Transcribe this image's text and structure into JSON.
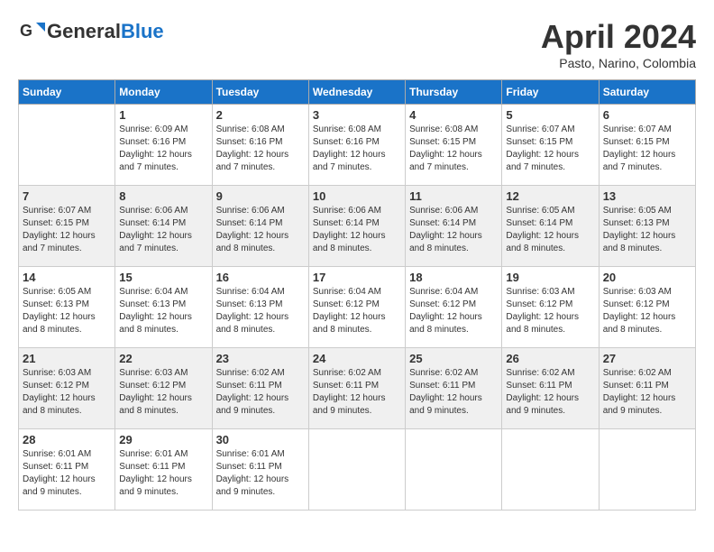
{
  "header": {
    "logo_general": "General",
    "logo_blue": "Blue",
    "month_year": "April 2024",
    "location": "Pasto, Narino, Colombia"
  },
  "weekdays": [
    "Sunday",
    "Monday",
    "Tuesday",
    "Wednesday",
    "Thursday",
    "Friday",
    "Saturday"
  ],
  "weeks": [
    [
      {
        "day": "",
        "info": ""
      },
      {
        "day": "1",
        "info": "Sunrise: 6:09 AM\nSunset: 6:16 PM\nDaylight: 12 hours\nand 7 minutes."
      },
      {
        "day": "2",
        "info": "Sunrise: 6:08 AM\nSunset: 6:16 PM\nDaylight: 12 hours\nand 7 minutes."
      },
      {
        "day": "3",
        "info": "Sunrise: 6:08 AM\nSunset: 6:16 PM\nDaylight: 12 hours\nand 7 minutes."
      },
      {
        "day": "4",
        "info": "Sunrise: 6:08 AM\nSunset: 6:15 PM\nDaylight: 12 hours\nand 7 minutes."
      },
      {
        "day": "5",
        "info": "Sunrise: 6:07 AM\nSunset: 6:15 PM\nDaylight: 12 hours\nand 7 minutes."
      },
      {
        "day": "6",
        "info": "Sunrise: 6:07 AM\nSunset: 6:15 PM\nDaylight: 12 hours\nand 7 minutes."
      }
    ],
    [
      {
        "day": "7",
        "info": "Sunrise: 6:07 AM\nSunset: 6:15 PM\nDaylight: 12 hours\nand 7 minutes."
      },
      {
        "day": "8",
        "info": "Sunrise: 6:06 AM\nSunset: 6:14 PM\nDaylight: 12 hours\nand 7 minutes."
      },
      {
        "day": "9",
        "info": "Sunrise: 6:06 AM\nSunset: 6:14 PM\nDaylight: 12 hours\nand 8 minutes."
      },
      {
        "day": "10",
        "info": "Sunrise: 6:06 AM\nSunset: 6:14 PM\nDaylight: 12 hours\nand 8 minutes."
      },
      {
        "day": "11",
        "info": "Sunrise: 6:06 AM\nSunset: 6:14 PM\nDaylight: 12 hours\nand 8 minutes."
      },
      {
        "day": "12",
        "info": "Sunrise: 6:05 AM\nSunset: 6:14 PM\nDaylight: 12 hours\nand 8 minutes."
      },
      {
        "day": "13",
        "info": "Sunrise: 6:05 AM\nSunset: 6:13 PM\nDaylight: 12 hours\nand 8 minutes."
      }
    ],
    [
      {
        "day": "14",
        "info": "Sunrise: 6:05 AM\nSunset: 6:13 PM\nDaylight: 12 hours\nand 8 minutes."
      },
      {
        "day": "15",
        "info": "Sunrise: 6:04 AM\nSunset: 6:13 PM\nDaylight: 12 hours\nand 8 minutes."
      },
      {
        "day": "16",
        "info": "Sunrise: 6:04 AM\nSunset: 6:13 PM\nDaylight: 12 hours\nand 8 minutes."
      },
      {
        "day": "17",
        "info": "Sunrise: 6:04 AM\nSunset: 6:12 PM\nDaylight: 12 hours\nand 8 minutes."
      },
      {
        "day": "18",
        "info": "Sunrise: 6:04 AM\nSunset: 6:12 PM\nDaylight: 12 hours\nand 8 minutes."
      },
      {
        "day": "19",
        "info": "Sunrise: 6:03 AM\nSunset: 6:12 PM\nDaylight: 12 hours\nand 8 minutes."
      },
      {
        "day": "20",
        "info": "Sunrise: 6:03 AM\nSunset: 6:12 PM\nDaylight: 12 hours\nand 8 minutes."
      }
    ],
    [
      {
        "day": "21",
        "info": "Sunrise: 6:03 AM\nSunset: 6:12 PM\nDaylight: 12 hours\nand 8 minutes."
      },
      {
        "day": "22",
        "info": "Sunrise: 6:03 AM\nSunset: 6:12 PM\nDaylight: 12 hours\nand 8 minutes."
      },
      {
        "day": "23",
        "info": "Sunrise: 6:02 AM\nSunset: 6:11 PM\nDaylight: 12 hours\nand 9 minutes."
      },
      {
        "day": "24",
        "info": "Sunrise: 6:02 AM\nSunset: 6:11 PM\nDaylight: 12 hours\nand 9 minutes."
      },
      {
        "day": "25",
        "info": "Sunrise: 6:02 AM\nSunset: 6:11 PM\nDaylight: 12 hours\nand 9 minutes."
      },
      {
        "day": "26",
        "info": "Sunrise: 6:02 AM\nSunset: 6:11 PM\nDaylight: 12 hours\nand 9 minutes."
      },
      {
        "day": "27",
        "info": "Sunrise: 6:02 AM\nSunset: 6:11 PM\nDaylight: 12 hours\nand 9 minutes."
      }
    ],
    [
      {
        "day": "28",
        "info": "Sunrise: 6:01 AM\nSunset: 6:11 PM\nDaylight: 12 hours\nand 9 minutes."
      },
      {
        "day": "29",
        "info": "Sunrise: 6:01 AM\nSunset: 6:11 PM\nDaylight: 12 hours\nand 9 minutes."
      },
      {
        "day": "30",
        "info": "Sunrise: 6:01 AM\nSunset: 6:11 PM\nDaylight: 12 hours\nand 9 minutes."
      },
      {
        "day": "",
        "info": ""
      },
      {
        "day": "",
        "info": ""
      },
      {
        "day": "",
        "info": ""
      },
      {
        "day": "",
        "info": ""
      }
    ]
  ]
}
